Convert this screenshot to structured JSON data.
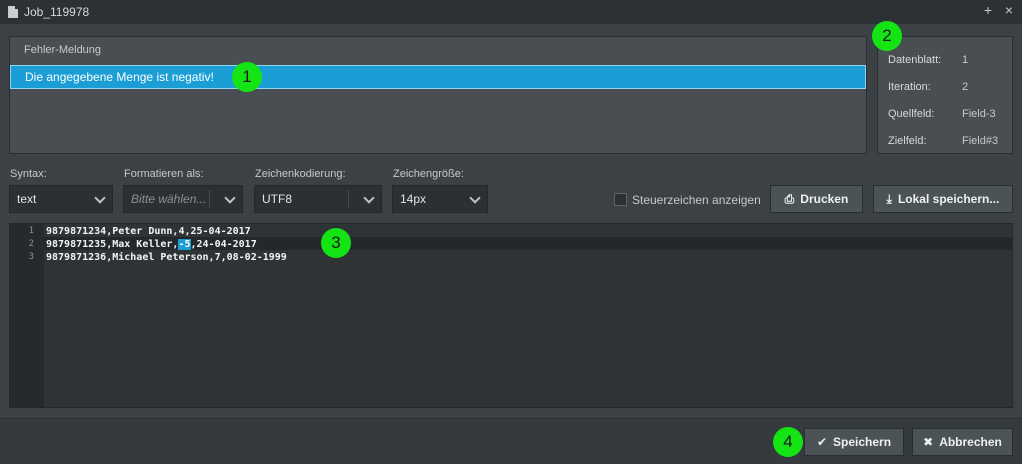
{
  "window": {
    "title": "Job_119978",
    "add_label": "+",
    "close_label": "×"
  },
  "error": {
    "header": "Fehler-Meldung",
    "message": "Die angegebene Menge ist negativ!"
  },
  "info": [
    {
      "label": "Datenblatt:",
      "value": "1"
    },
    {
      "label": "Iteration:",
      "value": "2"
    },
    {
      "label": "Quellfeld:",
      "value": "Field-3"
    },
    {
      "label": "Zielfeld:",
      "value": "Field#3"
    }
  ],
  "toolbar": {
    "syntax_label": "Syntax:",
    "syntax_value": "text",
    "format_label": "Formatieren als:",
    "format_placeholder": "Bitte wählen...",
    "encoding_label": "Zeichenkodierung:",
    "encoding_value": "UTF8",
    "fontsize_label": "Zeichengröße:",
    "fontsize_value": "14px",
    "control_chars_label": "Steuerzeichen anzeigen",
    "print_label": "Drucken",
    "save_local_label": "Lokal speichern..."
  },
  "editor": {
    "lines": [
      {
        "number": "1",
        "text": "9879871234,Peter Dunn,4,25-04-2017"
      },
      {
        "number": "2",
        "before": "9879871235,Max Keller,",
        "selected": "-5",
        "after": ",24-04-2017"
      },
      {
        "number": "3",
        "text": "9879871236,Michael Peterson,7,08-02-1999"
      }
    ]
  },
  "footer": {
    "save_label": "Speichern",
    "cancel_label": "Abbrechen"
  },
  "markers": [
    "1",
    "2",
    "3",
    "4"
  ],
  "colors": {
    "accent": "#1b9ed6",
    "marker": "#14e314",
    "background": "#3b4145"
  }
}
